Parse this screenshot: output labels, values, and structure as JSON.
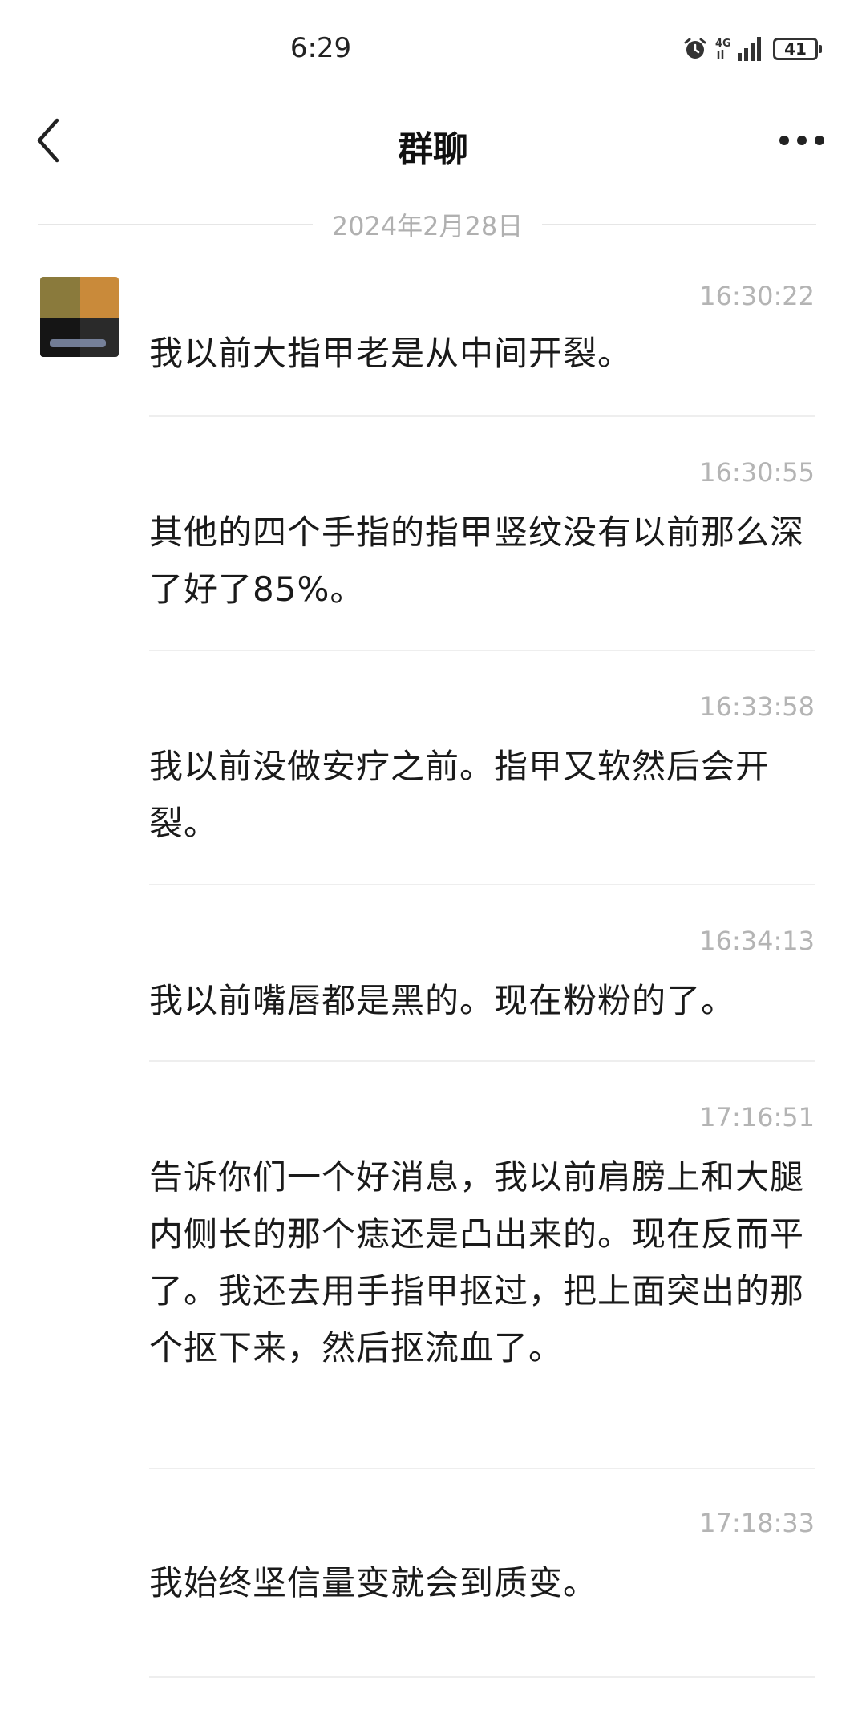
{
  "status_bar": {
    "time": "6:29",
    "network": "4G",
    "battery": "41",
    "icons": [
      "alarm-icon",
      "signal-icon",
      "battery-icon"
    ]
  },
  "header": {
    "title": "群聊",
    "back_icon": "chevron-left-icon",
    "more_icon": "more-dots-icon"
  },
  "date_divider": "2024年2月28日",
  "messages": [
    {
      "time": "16:30:22",
      "text": "我以前大指甲老是从中间开裂。"
    },
    {
      "time": "16:30:55",
      "text": "其他的四个手指的指甲竖纹没有以前那么深了好了85%。"
    },
    {
      "time": "16:33:58",
      "text": "我以前没做安疗之前。指甲又软然后会开裂。"
    },
    {
      "time": "16:34:13",
      "text": "我以前嘴唇都是黑的。现在粉粉的了。"
    },
    {
      "time": "17:16:51",
      "text": "告诉你们一个好消息，我以前肩膀上和大腿内侧长的那个痣还是凸出来的。现在反而平了。我还去用手指甲抠过，把上面突出的那个抠下来，然后抠流血了。"
    },
    {
      "time": "17:18:33",
      "text": "我始终坚信量变就会到质变。"
    }
  ]
}
